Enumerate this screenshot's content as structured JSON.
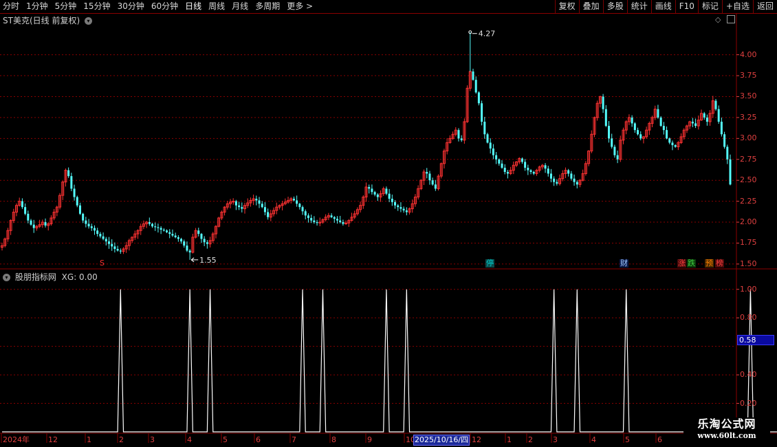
{
  "toolbar": {
    "periods": [
      "分时",
      "1分钟",
      "5分钟",
      "15分钟",
      "30分钟",
      "60分钟",
      "日线",
      "周线",
      "月线",
      "多周期",
      "更多 >"
    ],
    "active_period": "日线",
    "tools": [
      "复权",
      "叠加",
      "多股",
      "统计",
      "画线",
      "F10",
      "标记",
      "+自选",
      "返回"
    ]
  },
  "main_panel": {
    "title": "ST美克(日线 前复权)",
    "y_ticks": [
      "4.00",
      "3.75",
      "3.50",
      "3.25",
      "3.00",
      "2.75",
      "2.50",
      "2.25",
      "2.00",
      "1.75",
      "1.50"
    ],
    "high_label": "4.27",
    "low_label": "1.55",
    "events": [
      {
        "text": "S",
        "color": "#ff3030"
      },
      {
        "text": "停",
        "color": "#00c8c8"
      },
      {
        "text": "财",
        "color": "#a0c8ff"
      },
      {
        "text": "涨",
        "color": "#ff4040"
      },
      {
        "text": "跌",
        "color": "#40d040"
      },
      {
        "text": "预",
        "color": "#ff8000"
      },
      {
        "text": "榜",
        "color": "#ff4040"
      }
    ]
  },
  "indicator_panel": {
    "title": "股朋指标网",
    "value_text": "XG: 0.00",
    "y_ticks": [
      "1.00",
      "0.80",
      "0.40",
      "0.20"
    ],
    "cursor_value": "0.58"
  },
  "x_axis": {
    "labels": [
      "2024年",
      "12",
      "1",
      "2",
      "3",
      "4",
      "5",
      "6",
      "7",
      "8",
      "9",
      "10",
      "2025/10/16/四",
      "12",
      "1",
      "2",
      "3",
      "4",
      "5",
      "6"
    ],
    "date_badge": "2025/10/16/四"
  },
  "watermark": {
    "title": "乐淘公式网",
    "url": "www.60lt.com"
  },
  "colors": {
    "up": "#ff3232",
    "down": "#54fcfc",
    "signal": "#ffffff",
    "grid": "#8b0000",
    "axis_label": "#e04040"
  },
  "chart_data": [
    {
      "type": "candlestick",
      "title": "ST美克(日线 前复权)",
      "ylim": [
        1.45,
        4.35
      ],
      "y_ticks": [
        1.5,
        1.75,
        2.0,
        2.25,
        2.5,
        2.75,
        3.0,
        3.25,
        3.5,
        3.75,
        4.0
      ],
      "annotations": [
        {
          "label": "4.27",
          "value": 4.27
        },
        {
          "label": "1.55",
          "value": 1.55
        }
      ],
      "close": [
        1.72,
        1.8,
        1.9,
        2.02,
        2.12,
        2.2,
        2.25,
        2.18,
        2.1,
        2.02,
        1.97,
        1.93,
        1.95,
        1.97,
        2.0,
        1.96,
        1.98,
        2.05,
        2.12,
        2.18,
        2.32,
        2.48,
        2.62,
        2.55,
        2.4,
        2.3,
        2.2,
        2.1,
        2.02,
        1.98,
        1.95,
        1.93,
        1.9,
        1.86,
        1.83,
        1.8,
        1.77,
        1.74,
        1.71,
        1.68,
        1.66,
        1.65,
        1.68,
        1.72,
        1.78,
        1.82,
        1.86,
        1.9,
        1.95,
        1.98,
        2.0,
        1.98,
        1.95,
        1.94,
        1.93,
        1.91,
        1.9,
        1.88,
        1.86,
        1.84,
        1.82,
        1.8,
        1.77,
        1.72,
        1.66,
        1.64,
        1.82,
        1.9,
        1.86,
        1.8,
        1.76,
        1.74,
        1.78,
        1.86,
        1.95,
        2.05,
        2.12,
        2.18,
        2.22,
        2.24,
        2.25,
        2.2,
        2.18,
        2.16,
        2.2,
        2.23,
        2.26,
        2.28,
        2.26,
        2.22,
        2.18,
        2.12,
        2.06,
        2.1,
        2.14,
        2.18,
        2.2,
        2.22,
        2.24,
        2.26,
        2.28,
        2.26,
        2.22,
        2.18,
        2.13,
        2.08,
        2.05,
        2.02,
        2.0,
        1.99,
        2.0,
        2.03,
        2.06,
        2.08,
        2.06,
        2.04,
        2.02,
        2.0,
        1.98,
        1.99,
        2.02,
        2.06,
        2.1,
        2.15,
        2.2,
        2.3,
        2.42,
        2.4,
        2.36,
        2.33,
        2.3,
        2.34,
        2.4,
        2.34,
        2.28,
        2.24,
        2.2,
        2.18,
        2.16,
        2.14,
        2.12,
        2.16,
        2.22,
        2.3,
        2.4,
        2.5,
        2.6,
        2.58,
        2.5,
        2.45,
        2.4,
        2.55,
        2.7,
        2.85,
        2.95,
        3.0,
        3.05,
        3.1,
        3.0,
        2.98,
        3.2,
        3.6,
        3.8,
        3.7,
        3.55,
        3.42,
        3.2,
        3.05,
        2.95,
        2.88,
        2.8,
        2.75,
        2.7,
        2.65,
        2.6,
        2.58,
        2.62,
        2.68,
        2.72,
        2.76,
        2.72,
        2.65,
        2.62,
        2.6,
        2.58,
        2.62,
        2.66,
        2.68,
        2.64,
        2.58,
        2.52,
        2.48,
        2.46,
        2.52,
        2.58,
        2.62,
        2.58,
        2.52,
        2.48,
        2.45,
        2.5,
        2.58,
        2.7,
        2.85,
        3.05,
        3.25,
        3.42,
        3.5,
        3.35,
        3.15,
        3.0,
        2.9,
        2.8,
        2.75,
        2.98,
        3.1,
        3.2,
        3.25,
        3.18,
        3.1,
        3.05,
        3.0,
        3.02,
        3.1,
        3.18,
        3.25,
        3.35,
        3.25,
        3.15,
        3.1,
        3.0,
        2.95,
        2.92,
        2.9,
        2.95,
        3.02,
        3.1,
        3.15,
        3.2,
        3.18,
        3.15,
        3.22,
        3.3,
        3.25,
        3.2,
        3.3,
        3.45,
        3.35,
        3.2,
        3.05,
        2.9,
        2.75,
        2.45
      ]
    },
    {
      "type": "line",
      "title": "股朋指标网",
      "series": [
        {
          "values": [
            0,
            0,
            0,
            0,
            0,
            0,
            0,
            0,
            0,
            0,
            0,
            0,
            0,
            0,
            0,
            0,
            0,
            0,
            0,
            0,
            0,
            0,
            0,
            0,
            0,
            0,
            0,
            0,
            0,
            0,
            0,
            0,
            0,
            0,
            0,
            0,
            0,
            0,
            0,
            0,
            0,
            1,
            0,
            0,
            0,
            0,
            0,
            0,
            0,
            0,
            0,
            0,
            0,
            0,
            0,
            0,
            0,
            0,
            0,
            0,
            0,
            0,
            0,
            0,
            0,
            1,
            0,
            0,
            0,
            0,
            0,
            0,
            1,
            0,
            0,
            0,
            0,
            0,
            0,
            0,
            0,
            0,
            0,
            0,
            0,
            0,
            0,
            0,
            0,
            0,
            0,
            0,
            0,
            0,
            0,
            0,
            0,
            0,
            0,
            0,
            0,
            0,
            0,
            0,
            1,
            0,
            0,
            0,
            0,
            0,
            0,
            1,
            0,
            0,
            0,
            0,
            0,
            0,
            0,
            0,
            0,
            0,
            0,
            0,
            0,
            0,
            0,
            0,
            0,
            0,
            0,
            0,
            0,
            1,
            0,
            0,
            0,
            0,
            0,
            0,
            1,
            0,
            0,
            0,
            0,
            0,
            0,
            0,
            0,
            0,
            0,
            0,
            0,
            0,
            0,
            0,
            0,
            0,
            0,
            0,
            0,
            0,
            0,
            0,
            0,
            0,
            0,
            0,
            0,
            0,
            0,
            0,
            0,
            0,
            0,
            0,
            0,
            0,
            0,
            0,
            0,
            0,
            0,
            0,
            0,
            0,
            0,
            0,
            0,
            0,
            0,
            1,
            0,
            0,
            0,
            0,
            0,
            0,
            0,
            1,
            0,
            0,
            0,
            0,
            0,
            0,
            0,
            0,
            0,
            0,
            0,
            0,
            0,
            0,
            0,
            0,
            1,
            0,
            0,
            0,
            0,
            0,
            0,
            0,
            0,
            0,
            0,
            0,
            0,
            0,
            0,
            0,
            0,
            0,
            0,
            0,
            0,
            0,
            0,
            0,
            0,
            0,
            0,
            0,
            0,
            0,
            0,
            0,
            0,
            0,
            0,
            0,
            0,
            0,
            0,
            0,
            0,
            0,
            0,
            1,
            0,
            0,
            0,
            0,
            0,
            0,
            0,
            0,
            0,
            0,
            0,
            0,
            0,
            0,
            0
          ]
        }
      ],
      "ylim": [
        0,
        1.1
      ],
      "y_ticks": [
        0.2,
        0.4,
        0.8,
        1.0
      ]
    }
  ]
}
